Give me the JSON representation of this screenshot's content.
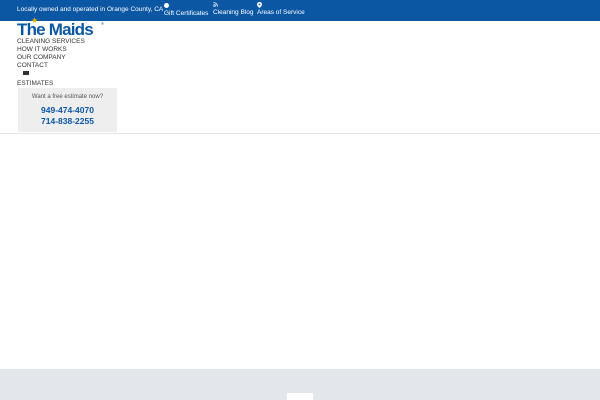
{
  "topbar": {
    "tagline": "Locally owned and operated in Orange County, CA",
    "links": [
      {
        "label": "Gift Certificates",
        "icon": "gift-icon"
      },
      {
        "label": "Cleaning Blog",
        "icon": "rss-icon",
        "glyph": "∷"
      },
      {
        "label": "Areas of Service",
        "icon": "map-pin-icon",
        "glyph": "⬤"
      }
    ],
    "background": "#0b57a4"
  },
  "logo": {
    "text": "The Maids",
    "star": "★",
    "trademark": "®",
    "color": "#0b57a4",
    "star_color": "#f2b705"
  },
  "nav": {
    "items": [
      {
        "label": "CLEANING SERVICES"
      },
      {
        "label": "HOW IT WORKS"
      },
      {
        "label": "OUR COMPANY"
      },
      {
        "label": "CONTACT"
      },
      {
        "label": "ESTIMATES",
        "icon": "envelope-icon"
      }
    ]
  },
  "estimate": {
    "prompt": "Want a free estimate now?",
    "phones": [
      "949-474-4070",
      "714-838-2255"
    ],
    "phone_color": "#0b57a4"
  },
  "footer": {
    "background": "#e3e6ea"
  }
}
